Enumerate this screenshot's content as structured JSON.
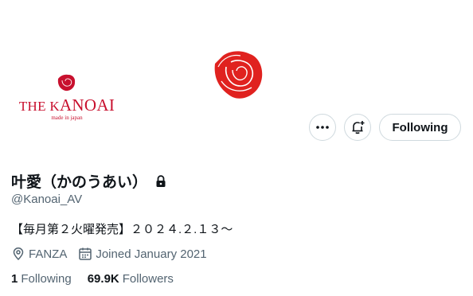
{
  "profile": {
    "display_name": "叶愛（かのうあい）",
    "handle": "@Kanoai_AV",
    "bio": "【毎月第２火曜発売】２０２４.２.１３〜",
    "location": "FANZA",
    "joined": "Joined January 2021"
  },
  "avatar": {
    "logo_prefix": "THE K",
    "logo_rest": "ANOAI",
    "logo_sub": "made in japan"
  },
  "actions": {
    "more_label": "•••",
    "follow_label": "Following"
  },
  "stats": {
    "following_count": "1",
    "following_label": "Following",
    "followers_count": "69.9K",
    "followers_label": "Followers"
  },
  "colors": {
    "brand_red": "#c8102e",
    "rose_red": "#e0221f",
    "text_primary": "#0f1419",
    "text_secondary": "#536471",
    "border": "#cfd9de"
  }
}
